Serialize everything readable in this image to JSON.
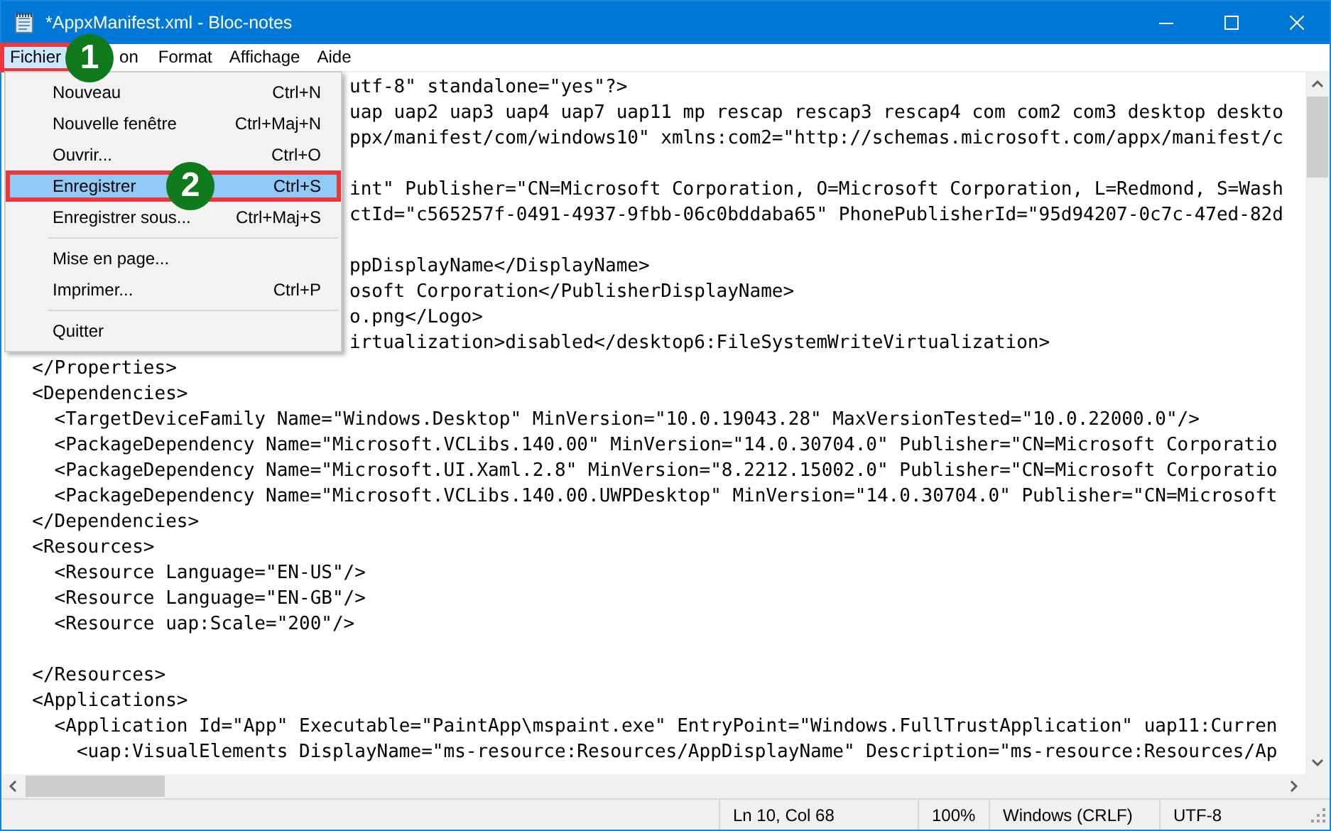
{
  "window": {
    "title": "*AppxManifest.xml - Bloc-notes"
  },
  "menubar": [
    {
      "label": "Fichier",
      "selected": true,
      "highlighted": true,
      "covered": false
    },
    {
      "label": "on",
      "selected": false,
      "highlighted": false,
      "covered": true
    },
    {
      "label": "Format",
      "selected": false,
      "highlighted": false,
      "covered": false
    },
    {
      "label": "Affichage",
      "selected": false,
      "highlighted": false,
      "covered": false
    },
    {
      "label": "Aide",
      "selected": false,
      "highlighted": false,
      "covered": false
    }
  ],
  "file_menu": [
    {
      "kind": "item",
      "label": "Nouveau",
      "shortcut": "Ctrl+N",
      "selected": false,
      "highlighted": false
    },
    {
      "kind": "item",
      "label": "Nouvelle fenêtre",
      "shortcut": "Ctrl+Maj+N",
      "selected": false,
      "highlighted": false
    },
    {
      "kind": "item",
      "label": "Ouvrir...",
      "shortcut": "Ctrl+O",
      "selected": false,
      "highlighted": false
    },
    {
      "kind": "item",
      "label": "Enregistrer",
      "shortcut": "Ctrl+S",
      "selected": true,
      "highlighted": true
    },
    {
      "kind": "item",
      "label": "Enregistrer sous...",
      "shortcut": "Ctrl+Maj+S",
      "selected": false,
      "highlighted": false
    },
    {
      "kind": "separator"
    },
    {
      "kind": "item",
      "label": "Mise en page...",
      "selected": false,
      "highlighted": false
    },
    {
      "kind": "item",
      "label": "Imprimer...",
      "shortcut": "Ctrl+P",
      "selected": false,
      "highlighted": false
    },
    {
      "kind": "separator"
    },
    {
      "kind": "item",
      "label": "Quitter",
      "selected": false,
      "highlighted": false
    }
  ],
  "callouts": [
    {
      "text": "1"
    },
    {
      "text": "2"
    }
  ],
  "editor": {
    "lines": [
      {
        "kind": "covered",
        "text": "utf-8\" standalone=\"yes\"?>"
      },
      {
        "kind": "covered",
        "text": "uap uap2 uap3 uap4 uap7 uap11 mp rescap rescap3 rescap4 com com2 com3 desktop deskto"
      },
      {
        "kind": "covered",
        "text": "ppx/manifest/com/windows10\" xmlns:com2=\"http://schemas.microsoft.com/appx/manifest/c"
      },
      {
        "kind": "blank"
      },
      {
        "kind": "covered",
        "text": "int\" Publisher=\"CN=Microsoft Corporation, O=Microsoft Corporation, L=Redmond, S=Wash"
      },
      {
        "kind": "covered",
        "text": "ctId=\"c565257f-0491-4937-9fbb-06c0bddaba65\" PhonePublisherId=\"95d94207-0c7c-47ed-82d"
      },
      {
        "kind": "blank"
      },
      {
        "kind": "covered",
        "text": "ppDisplayName</DisplayName>"
      },
      {
        "kind": "covered",
        "text": "osoft Corporation</PublisherDisplayName>"
      },
      {
        "kind": "covered",
        "text": "o.png</Logo>"
      },
      {
        "kind": "covered",
        "text": "irtualization>disabled</desktop6:FileSystemWriteVirtualization>"
      },
      {
        "kind": "code",
        "text": "  </Properties>"
      },
      {
        "kind": "code",
        "text": "  <Dependencies>"
      },
      {
        "kind": "code",
        "text": "    <TargetDeviceFamily Name=\"Windows.Desktop\" MinVersion=\"10.0.19043.28\" MaxVersionTested=\"10.0.22000.0\"/>"
      },
      {
        "kind": "code",
        "text": "    <PackageDependency Name=\"Microsoft.VCLibs.140.00\" MinVersion=\"14.0.30704.0\" Publisher=\"CN=Microsoft Corporatio"
      },
      {
        "kind": "code",
        "text": "    <PackageDependency Name=\"Microsoft.UI.Xaml.2.8\" MinVersion=\"8.2212.15002.0\" Publisher=\"CN=Microsoft Corporatio"
      },
      {
        "kind": "code",
        "text": "    <PackageDependency Name=\"Microsoft.VCLibs.140.00.UWPDesktop\" MinVersion=\"14.0.30704.0\" Publisher=\"CN=Microsoft"
      },
      {
        "kind": "code",
        "text": "  </Dependencies>"
      },
      {
        "kind": "code",
        "text": "  <Resources>"
      },
      {
        "kind": "code",
        "text": "    <Resource Language=\"EN-US\"/>"
      },
      {
        "kind": "code",
        "text": "    <Resource Language=\"EN-GB\"/>"
      },
      {
        "kind": "code",
        "text": "    <Resource uap:Scale=\"200\"/>"
      },
      {
        "kind": "blank"
      },
      {
        "kind": "code",
        "text": "  </Resources>"
      },
      {
        "kind": "code",
        "text": "  <Applications>"
      },
      {
        "kind": "code",
        "text": "    <Application Id=\"App\" Executable=\"PaintApp\\mspaint.exe\" EntryPoint=\"Windows.FullTrustApplication\" uap11:Curren"
      },
      {
        "kind": "code",
        "text": "      <uap:VisualElements DisplayName=\"ms-resource:Resources/AppDisplayName\" Description=\"ms-resource:Resources/Ap"
      }
    ]
  },
  "status_bar": [
    "Ln 10, Col 68",
    "100%",
    "Windows (CRLF)",
    "UTF-8"
  ]
}
